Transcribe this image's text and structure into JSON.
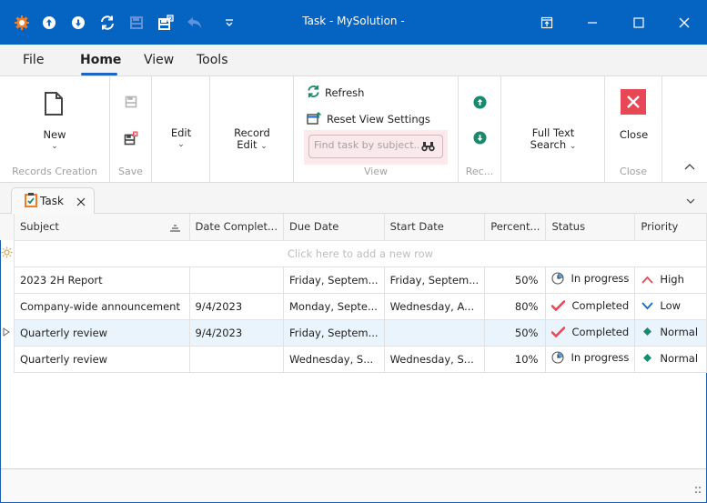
{
  "window": {
    "title": "Task - MySolution -",
    "accent": "#0563c1",
    "quick_access": [
      {
        "icon": "app-logo-icon"
      },
      {
        "icon": "previous-record-icon"
      },
      {
        "icon": "next-record-icon"
      },
      {
        "icon": "refresh-icon"
      },
      {
        "icon": "save-icon",
        "disabled": true
      },
      {
        "icon": "save-and-close-icon"
      },
      {
        "icon": "undo-icon",
        "disabled": true
      },
      {
        "icon": "customize-toolbar-icon"
      }
    ],
    "controls": [
      "restore-ribbon-icon",
      "minimize-icon",
      "maximize-icon",
      "close-icon"
    ]
  },
  "ribbon": {
    "tabs": [
      {
        "label": "File",
        "active": false
      },
      {
        "label": "Home",
        "active": true
      },
      {
        "label": "View",
        "active": false
      },
      {
        "label": "Tools",
        "active": false
      }
    ],
    "groups": {
      "records_creation": {
        "label": "Records Creation",
        "new_label": "New"
      },
      "save": {
        "label": "Save"
      },
      "edit": {
        "label": "Edit"
      },
      "record_edit": {
        "line1": "Record",
        "line2": "Edit"
      },
      "view": {
        "label": "View",
        "refresh_label": "Refresh",
        "reset_label": "Reset View Settings",
        "search_placeholder": "Find task by subject..."
      },
      "records_navigation": {
        "label": "Rec..."
      },
      "full_text_search": {
        "line1": "Full Text",
        "line2": "Search"
      },
      "close": {
        "label": "Close",
        "button_label": "Close",
        "color": "#e84855"
      }
    }
  },
  "document_tab": {
    "label": "Task"
  },
  "grid": {
    "columns": [
      "Subject",
      "Date Complet...",
      "Due Date",
      "Start Date",
      "Percent...",
      "Status",
      "Priority"
    ],
    "new_row_text": "Click here to add a new row",
    "rows": [
      {
        "subject": "2023 2H Report",
        "date_completed": "",
        "due_date": "Friday, Septem...",
        "start_date": "Friday, Septem...",
        "percent": "50%",
        "status": "In progress",
        "status_icon": "clock-icon",
        "priority": "High",
        "priority_icon": "chevron-up-icon",
        "focused": false
      },
      {
        "subject": "Company-wide announcement",
        "date_completed": "9/4/2023",
        "due_date": "Monday, Septe...",
        "start_date": "Wednesday, A...",
        "percent": "80%",
        "status": "Completed",
        "status_icon": "checkmark-icon",
        "priority": "Low",
        "priority_icon": "chevron-down-icon",
        "focused": false
      },
      {
        "subject": "Quarterly review",
        "date_completed": "9/4/2023",
        "due_date": "Friday, Septem...",
        "start_date": "",
        "percent": "50%",
        "status": "Completed",
        "status_icon": "checkmark-icon",
        "priority": "Normal",
        "priority_icon": "diamond-icon",
        "focused": true
      },
      {
        "subject": "Quarterly review",
        "date_completed": "",
        "due_date": "Wednesday, S...",
        "start_date": "Wednesday, S...",
        "percent": "10%",
        "status": "In progress",
        "status_icon": "clock-icon",
        "priority": "Normal",
        "priority_icon": "diamond-icon",
        "focused": false
      }
    ],
    "colors": {
      "high": "#e84855",
      "low": "#1a66c2",
      "normal": "#1a8a6e",
      "completed": "#e84855"
    }
  }
}
